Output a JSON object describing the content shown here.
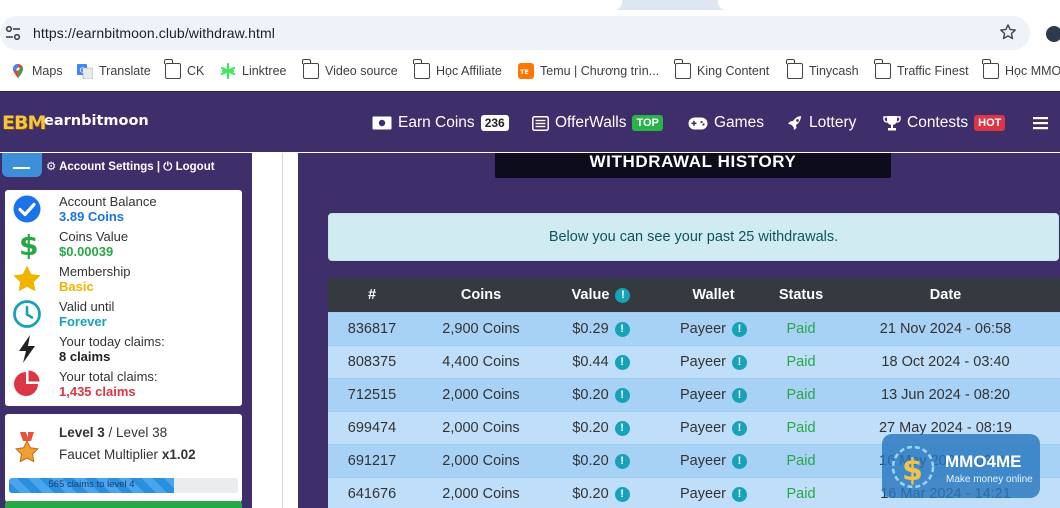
{
  "browser": {
    "url": "https://earnbitmoon.club/withdraw.html",
    "bookmarks": [
      "Maps",
      "Translate",
      "CK",
      "Linktree",
      "Video source",
      "Học Affiliate",
      "Temu | Chương trìn...",
      "King Content",
      "Tinycash",
      "Traffic Finest",
      "Học MMO"
    ]
  },
  "site": {
    "logo_mark": "EBM",
    "logo_text": "earnbitmoon",
    "nav": {
      "earn_coins": "Earn Coins",
      "earn_count": "236",
      "offerwalls": "OfferWalls",
      "offerwalls_badge": "TOP",
      "games": "Games",
      "lottery": "Lottery",
      "contests": "Contests",
      "contests_badge": "HOT"
    }
  },
  "sidebar": {
    "account_settings": "Account Settings",
    "separator": "|",
    "logout": "Logout",
    "info": [
      {
        "label": "Account Balance",
        "value": "3.89 Coins",
        "icon": "check-circle-icon",
        "color": "#1a73e8"
      },
      {
        "label": "Coins Value",
        "value": "$0.00039",
        "icon": "dollar-icon",
        "color": "#28a745"
      },
      {
        "label": "Membership",
        "value": "Basic",
        "icon": "star-icon",
        "color": "#f0b400"
      },
      {
        "label": "Valid until",
        "value": "Forever",
        "icon": "clock-icon",
        "color": "#17a2b8"
      },
      {
        "label": "Your today claims:",
        "value": "8 claims",
        "icon": "bolt-icon",
        "color": "#222222"
      },
      {
        "label": "Your total claims:",
        "value": "1,435 claims",
        "icon": "pie-chart-icon",
        "color": "#dc3545"
      }
    ],
    "level": {
      "level_text": "Level 3",
      "level_max": "/ Level 38",
      "multiplier_label": "Faucet Multiplier",
      "multiplier_value": "x1.02",
      "progress_text": "565 claims to level 4",
      "progress_fraction": 0.72
    }
  },
  "main": {
    "title": "WITHDRAWAL HISTORY",
    "alert": "Below you can see your past 25 withdrawals.",
    "columns": [
      "#",
      "Coins",
      "Value",
      "Wallet",
      "Status",
      "Date"
    ],
    "rows": [
      {
        "id": "836817",
        "coins": "2,900 Coins",
        "value": "$0.29",
        "wallet": "Payeer",
        "status": "Paid",
        "date": "21 Nov 2024 - 06:58"
      },
      {
        "id": "808375",
        "coins": "4,400 Coins",
        "value": "$0.44",
        "wallet": "Payeer",
        "status": "Paid",
        "date": "18 Oct 2024 - 03:40"
      },
      {
        "id": "712515",
        "coins": "2,000 Coins",
        "value": "$0.20",
        "wallet": "Payeer",
        "status": "Paid",
        "date": "13 Jun 2024 - 08:20"
      },
      {
        "id": "699474",
        "coins": "2,000 Coins",
        "value": "$0.20",
        "wallet": "Payeer",
        "status": "Paid",
        "date": "27 May 2024 - 08:19"
      },
      {
        "id": "691217",
        "coins": "2,000 Coins",
        "value": "$0.20",
        "wallet": "Payeer",
        "status": "Paid",
        "date": "16 May 2024 - 03:22"
      },
      {
        "id": "641676",
        "coins": "2,000 Coins",
        "value": "$0.20",
        "wallet": "Payeer",
        "status": "Paid",
        "date": "16 Mar 2024 - 14:21"
      }
    ]
  },
  "watermark": {
    "title": "MMO4ME",
    "subtitle": "Make money online"
  }
}
